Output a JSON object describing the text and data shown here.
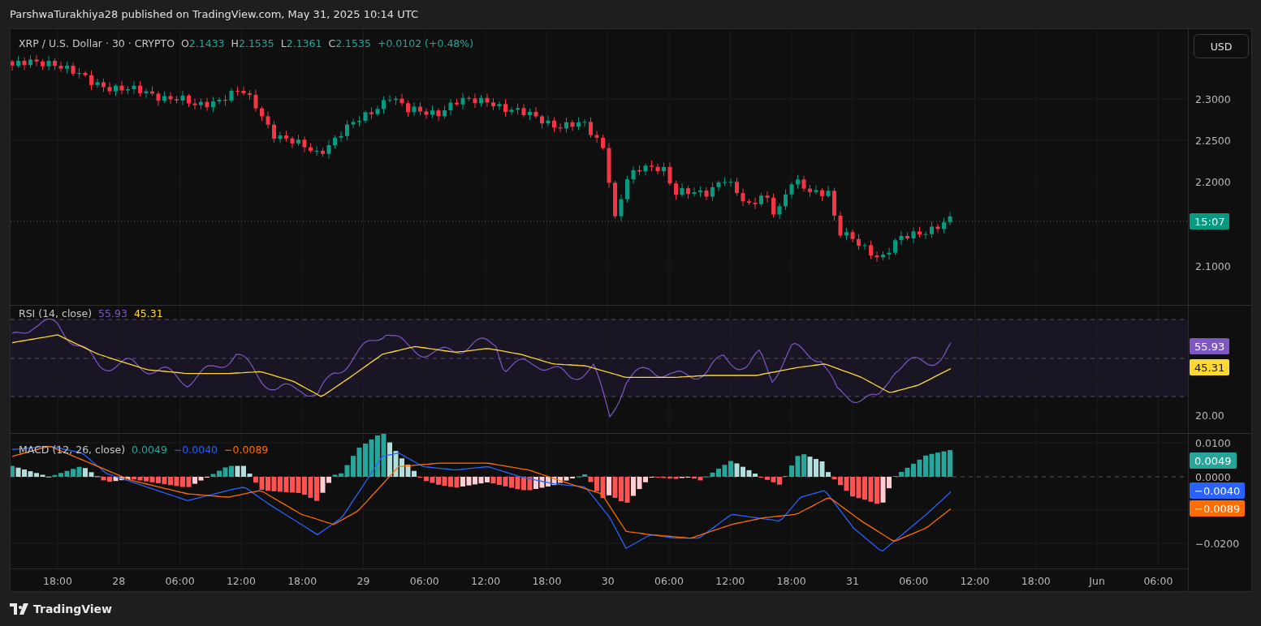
{
  "attribution": "ParshwaTurakhiya28 published on TradingView.com, May 31, 2025 10:14 UTC",
  "main_pane": {
    "legend": {
      "symbol": "XRP / U.S. Dollar · 30 · CRYPTO",
      "values": [
        {
          "key": "O",
          "value": "2.1433"
        },
        {
          "key": "H",
          "value": "2.1535"
        },
        {
          "key": "L",
          "value": "2.1361"
        },
        {
          "key": "C",
          "value": "2.1535"
        }
      ],
      "change": "+0.0102 (+0.48%)"
    },
    "currency_button": "USD",
    "price_ticks": [
      "2.3000",
      "2.2500",
      "2.2000",
      "2.1000"
    ],
    "countdown_badge": "15:07"
  },
  "rsi_pane": {
    "legend": {
      "title": "RSI (14, close)",
      "values": [
        {
          "value": "55.93",
          "color": "#7e57c2"
        },
        {
          "value": "45.31",
          "color": "#fdd835"
        }
      ]
    },
    "ticks": [
      "20.00"
    ],
    "badges": [
      {
        "value": "55.93",
        "color": "#7e57c2"
      },
      {
        "value": "45.31",
        "color": "#fdd835"
      }
    ]
  },
  "macd_pane": {
    "legend": {
      "title": "MACD (12, 26, close)",
      "values": [
        {
          "value": "0.0049",
          "color": "#26a69a"
        },
        {
          "value": "−0.0040",
          "color": "#2962ff"
        },
        {
          "value": "−0.0089",
          "color": "#ff6d00"
        }
      ]
    },
    "ticks": [
      "0.0100",
      "0.0000",
      "−0.0200"
    ],
    "badges": [
      {
        "value": "0.0049",
        "color": "#26a69a"
      },
      {
        "value": "−0.0040",
        "color": "#2962ff"
      },
      {
        "value": "−0.0089",
        "color": "#ff6d00"
      }
    ]
  },
  "time_axis": [
    "18:00",
    "28",
    "06:00",
    "12:00",
    "18:00",
    "29",
    "06:00",
    "12:00",
    "18:00",
    "30",
    "06:00",
    "12:00",
    "18:00",
    "31",
    "06:00",
    "12:00",
    "18:00",
    "Jun",
    "06:00"
  ],
  "footer": {
    "logo": "TradingView"
  }
}
